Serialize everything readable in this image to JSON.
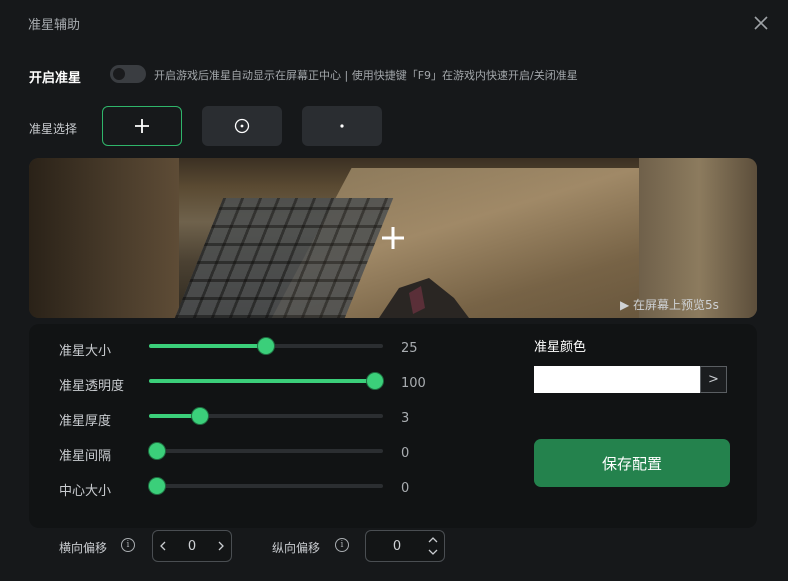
{
  "window": {
    "title": "准星辅助"
  },
  "toggle": {
    "label": "开启准星",
    "hint": "开启游戏后准星自动显示在屏幕正中心 | 使用快捷键「F9」在游戏内快速开启/关闭准星",
    "enabled": false
  },
  "crosshair_select": {
    "label": "准星选择",
    "options": [
      {
        "icon": "plus-crosshair-icon",
        "selected": true
      },
      {
        "icon": "circle-dot-crosshair-icon",
        "selected": false
      },
      {
        "icon": "dot-crosshair-icon",
        "selected": false
      }
    ]
  },
  "preview": {
    "text": "▶ 在屏幕上预览5s"
  },
  "sliders": [
    {
      "label": "准星大小",
      "value": "25",
      "level": 0.5
    },
    {
      "label": "准星透明度",
      "value": "100",
      "level": 1.0
    },
    {
      "label": "准星厚度",
      "value": "3",
      "level": 0.22
    },
    {
      "label": "准星间隔",
      "value": "0",
      "level": 0.0
    },
    {
      "label": "中心大小",
      "value": "0",
      "level": 0.0
    }
  ],
  "color": {
    "label": "准星颜色",
    "value": "#ffffff",
    "button": ">"
  },
  "save": {
    "label": "保存配置"
  },
  "offsets": {
    "horizontal": {
      "label": "横向偏移",
      "value": "0"
    },
    "vertical": {
      "label": "纵向偏移",
      "value": "0"
    }
  },
  "accent": "#3bcf7a",
  "primary_button_color": "#24824d"
}
